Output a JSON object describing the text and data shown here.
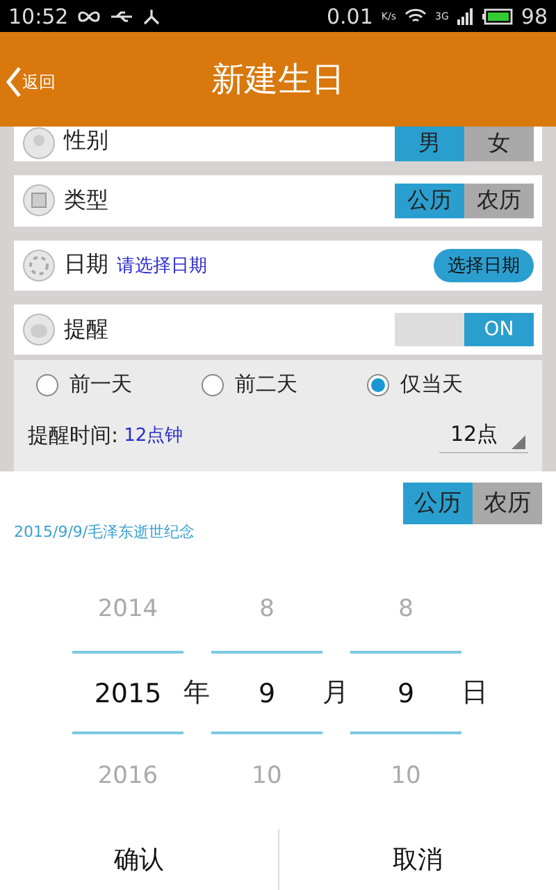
{
  "status_bar": {
    "time": "10:52",
    "speed": "0.01",
    "speed_unit": "K/s",
    "network": "3G",
    "battery": "98"
  },
  "header": {
    "back": "返回",
    "title": "新建生日"
  },
  "rows": [
    {
      "kind": "segment",
      "label": "性别",
      "options": [
        {
          "label": "男",
          "selected": true
        },
        {
          "label": "女",
          "selected": false
        }
      ]
    },
    {
      "kind": "segment",
      "label": "类型",
      "options": [
        {
          "label": "公历",
          "selected": true
        },
        {
          "label": "农历",
          "selected": false
        }
      ]
    },
    {
      "kind": "date",
      "label": "日期",
      "hint": "请选择日期",
      "button": "选择日期"
    },
    {
      "kind": "toggle",
      "label": "提醒",
      "on": true,
      "on_text": "ON"
    }
  ],
  "reminder": {
    "options": [
      {
        "label": "前一天",
        "selected": false
      },
      {
        "label": "前二天",
        "selected": false
      },
      {
        "label": "仅当天",
        "selected": true
      }
    ],
    "time_label": "提醒时间:",
    "time_value": "12点钟",
    "dropdown": "12点"
  },
  "picker": {
    "event": "2015/9/9/毛泽东逝世纪念",
    "calendar": [
      {
        "label": "公历",
        "selected": true
      },
      {
        "label": "农历",
        "selected": false
      }
    ],
    "columns": [
      {
        "above": "2014",
        "value": "2015",
        "below": "2016",
        "unit": "年"
      },
      {
        "above": "8",
        "value": "9",
        "below": "10",
        "unit": "月"
      },
      {
        "above": "8",
        "value": "9",
        "below": "10",
        "unit": "日"
      }
    ],
    "buttons": [
      "确认",
      "取消"
    ]
  }
}
